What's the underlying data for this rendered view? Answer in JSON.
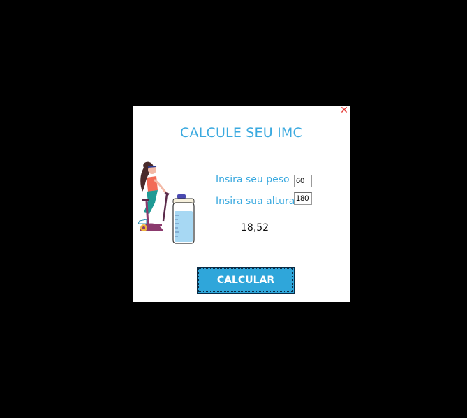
{
  "window": {
    "title": "CALCULE SEU IMC",
    "close_glyph": "✕"
  },
  "form": {
    "weight_label": "Insira seu peso",
    "weight_value": "60",
    "height_label": "Insira sua altura",
    "height_value": "180"
  },
  "result": {
    "value": "18,52"
  },
  "actions": {
    "calculate_label": "CALCULAR"
  },
  "colors": {
    "accent": "#3aa9df",
    "button": "#2fa6da",
    "close": "#e53935",
    "background": "#000000",
    "panel": "#ffffff"
  },
  "illustration": {
    "icon": "woman-exercise-bike-with-water-bottle-icon"
  }
}
